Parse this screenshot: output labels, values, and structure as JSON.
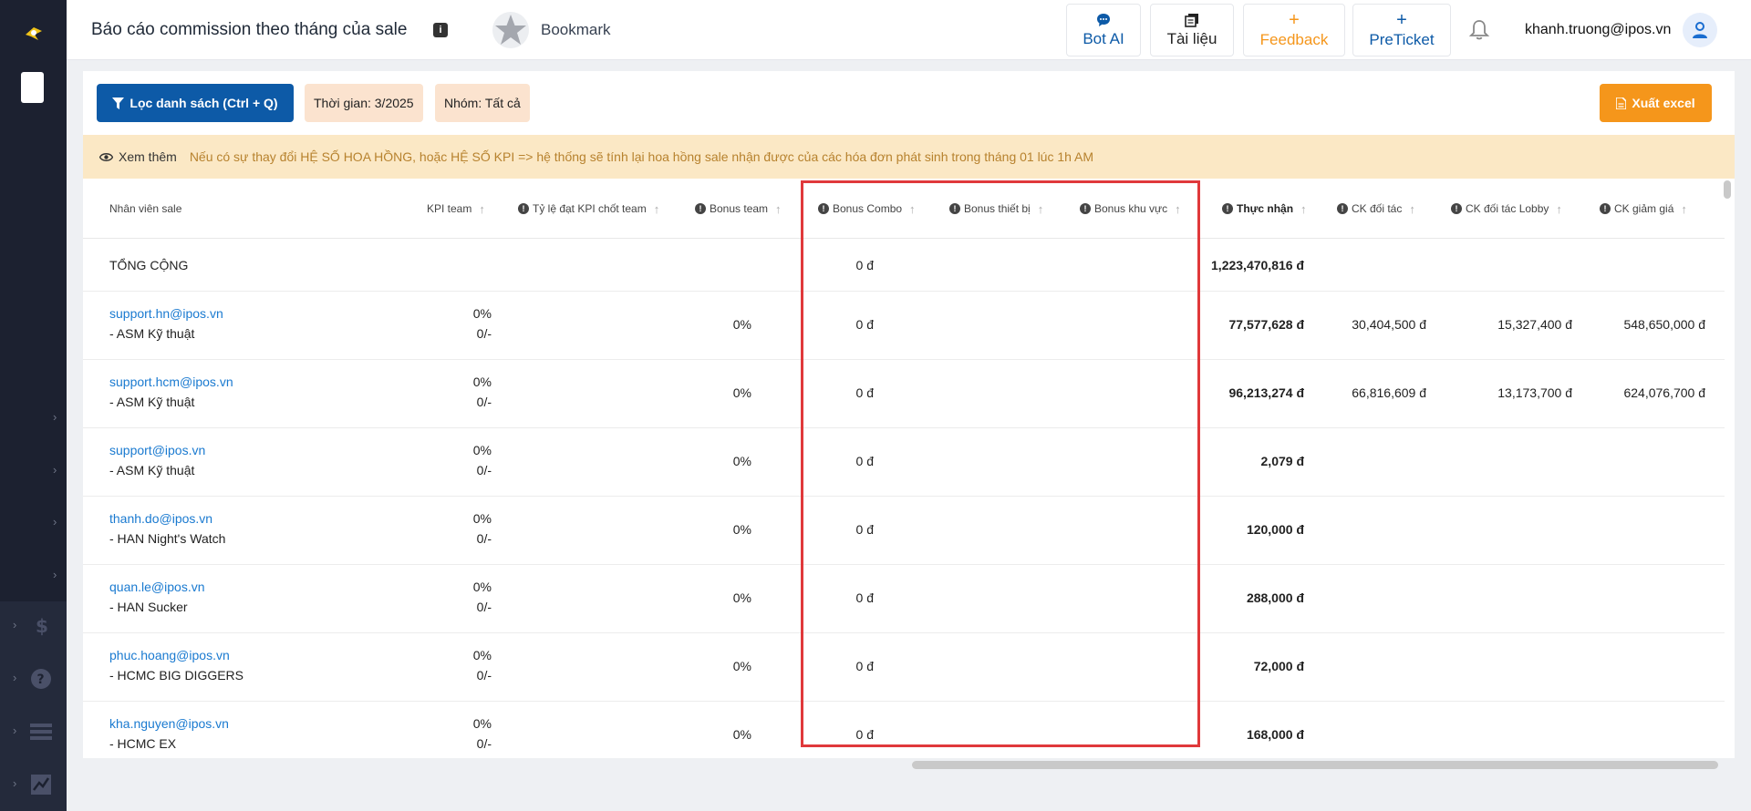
{
  "header": {
    "title": "Báo cáo commission theo tháng của sale",
    "info_icon": "info-icon",
    "bookmark_label": "Bookmark",
    "buttons": [
      {
        "icon": "chat-icon",
        "label": "Bot AI",
        "color": "#0d5aa7"
      },
      {
        "icon": "document-icon",
        "label": "Tài liệu",
        "color": "#222222"
      },
      {
        "icon": "plus-icon",
        "label": "Feedback",
        "color": "#f5961b"
      },
      {
        "icon": "plus-icon",
        "label": "PreTicket",
        "color": "#0d5aa7"
      }
    ],
    "user_email": "khanh.truong@ipos.vn"
  },
  "toolbar": {
    "filter_label": "Lọc danh sách (Ctrl + Q)",
    "time_chip": "Thời gian: 3/2025",
    "group_chip": "Nhóm: Tất cả",
    "export_label": "Xuất excel"
  },
  "notice": {
    "see_more": "Xem thêm",
    "message": "Nếu có sự thay đổi HỆ SỐ HOA HỒNG, hoặc HỆ SỐ KPI => hệ thống sẽ tính lại hoa hồng sale nhận được của các hóa đơn phát sinh trong tháng 01 lúc 1h AM"
  },
  "table": {
    "columns": [
      {
        "label": "Nhân viên sale"
      },
      {
        "label": "KPI team"
      },
      {
        "label": "Tỷ lệ đạt KPI chốt team"
      },
      {
        "label": "Bonus team"
      },
      {
        "label": "Bonus Combo"
      },
      {
        "label": "Bonus thiết bị"
      },
      {
        "label": "Bonus khu vực"
      },
      {
        "label": "Thực nhận"
      },
      {
        "label": "CK đối tác"
      },
      {
        "label": "CK đối tác Lobby"
      },
      {
        "label": "CK giảm giá"
      }
    ],
    "total": {
      "label": "TỔNG CỘNG",
      "bonus_team": "0 đ",
      "thuc_nhan": "1,223,470,816 đ"
    },
    "rows": [
      {
        "email": "support.hn@ipos.vn",
        "team": "- ASM Kỹ thuật",
        "kpi_pct": "0%",
        "kpi_ratio": "0/-",
        "ty_le": "0%",
        "bonus_team": "0 đ",
        "thuc_nhan": "77,577,628 đ",
        "ck_doi_tac": "30,404,500 đ",
        "ck_lobby": "15,327,400 đ",
        "ck_giam_gia": "548,650,000 đ"
      },
      {
        "email": "support.hcm@ipos.vn",
        "team": "- ASM Kỹ thuật",
        "kpi_pct": "0%",
        "kpi_ratio": "0/-",
        "ty_le": "0%",
        "bonus_team": "0 đ",
        "thuc_nhan": "96,213,274 đ",
        "ck_doi_tac": "66,816,609 đ",
        "ck_lobby": "13,173,700 đ",
        "ck_giam_gia": "624,076,700 đ"
      },
      {
        "email": "support@ipos.vn",
        "team": "- ASM Kỹ thuật",
        "kpi_pct": "0%",
        "kpi_ratio": "0/-",
        "ty_le": "0%",
        "bonus_team": "0 đ",
        "thuc_nhan": "2,079 đ",
        "ck_doi_tac": "",
        "ck_lobby": "",
        "ck_giam_gia": ""
      },
      {
        "email": "thanh.do@ipos.vn",
        "team": "- HAN Night's Watch",
        "kpi_pct": "0%",
        "kpi_ratio": "0/-",
        "ty_le": "0%",
        "bonus_team": "0 đ",
        "thuc_nhan": "120,000 đ",
        "ck_doi_tac": "",
        "ck_lobby": "",
        "ck_giam_gia": ""
      },
      {
        "email": "quan.le@ipos.vn",
        "team": "- HAN Sucker",
        "kpi_pct": "0%",
        "kpi_ratio": "0/-",
        "ty_le": "0%",
        "bonus_team": "0 đ",
        "thuc_nhan": "288,000 đ",
        "ck_doi_tac": "",
        "ck_lobby": "",
        "ck_giam_gia": ""
      },
      {
        "email": "phuc.hoang@ipos.vn",
        "team": "- HCMC BIG DIGGERS",
        "kpi_pct": "0%",
        "kpi_ratio": "0/-",
        "ty_le": "0%",
        "bonus_team": "0 đ",
        "thuc_nhan": "72,000 đ",
        "ck_doi_tac": "",
        "ck_lobby": "",
        "ck_giam_gia": ""
      },
      {
        "email": "kha.nguyen@ipos.vn",
        "team": "- HCMC EX",
        "kpi_pct": "0%",
        "kpi_ratio": "0/-",
        "ty_le": "0%",
        "bonus_team": "0 đ",
        "thuc_nhan": "168,000 đ",
        "ck_doi_tac": "",
        "ck_lobby": "",
        "ck_giam_gia": ""
      }
    ]
  },
  "colors": {
    "primary": "#0d5aa7",
    "accent": "#f5961b",
    "highlight_box": "#e0393b",
    "link": "#1a7ad0"
  }
}
